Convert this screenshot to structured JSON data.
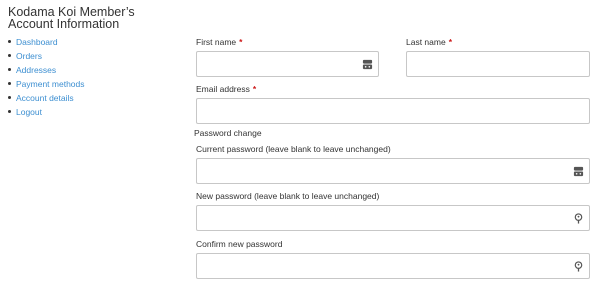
{
  "sidebar": {
    "title": "Kodama Koi Member’s Account Information",
    "nav": [
      {
        "label": "Dashboard"
      },
      {
        "label": "Orders"
      },
      {
        "label": "Addresses"
      },
      {
        "label": "Payment methods"
      },
      {
        "label": "Account details"
      },
      {
        "label": "Logout"
      }
    ]
  },
  "form": {
    "first_name": {
      "label": "First name",
      "required_mark": "*",
      "value": ""
    },
    "last_name": {
      "label": "Last name",
      "required_mark": "*",
      "value": ""
    },
    "email": {
      "label": "Email address",
      "required_mark": "*",
      "value": ""
    },
    "password_section": {
      "heading": "Password change"
    },
    "current_password": {
      "label": "Current password (leave blank to leave unchanged)",
      "value": ""
    },
    "new_password": {
      "label": "New password (leave blank to leave unchanged)",
      "value": ""
    },
    "confirm_password": {
      "label": "Confirm new password",
      "value": ""
    }
  },
  "icons": {
    "autofill": "password-manager-icon",
    "key": "password-key-icon"
  },
  "colors": {
    "link": "#3d8fd1",
    "required": "#cc1818",
    "border": "#c7c7c7"
  }
}
